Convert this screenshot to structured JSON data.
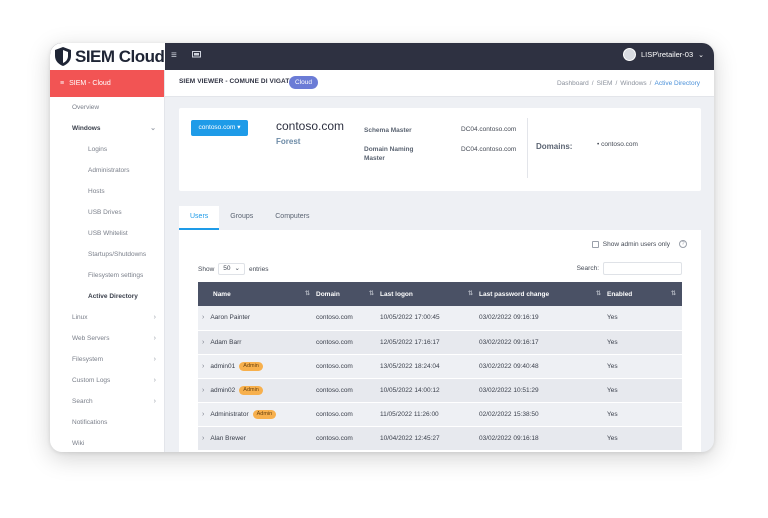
{
  "app": {
    "title": "SIEM Cloud",
    "user": "LISP\\retailer-03"
  },
  "sidebar": {
    "header": "SIEM - Cloud",
    "items": [
      {
        "label": "Overview",
        "sub": false,
        "bold": false,
        "chev": ""
      },
      {
        "label": "Windows",
        "sub": false,
        "bold": true,
        "chev": "⌄"
      },
      {
        "label": "Logins",
        "sub": true,
        "bold": false,
        "chev": ""
      },
      {
        "label": "Administrators",
        "sub": true,
        "bold": false,
        "chev": ""
      },
      {
        "label": "Hosts",
        "sub": true,
        "bold": false,
        "chev": ""
      },
      {
        "label": "USB Drives",
        "sub": true,
        "bold": false,
        "chev": ""
      },
      {
        "label": "USB Whitelist",
        "sub": true,
        "bold": false,
        "chev": ""
      },
      {
        "label": "Startups/Shutdowns",
        "sub": true,
        "bold": false,
        "chev": ""
      },
      {
        "label": "Filesystem settings",
        "sub": true,
        "bold": false,
        "chev": ""
      },
      {
        "label": "Active Directory",
        "sub": true,
        "bold": true,
        "chev": ""
      },
      {
        "label": "Linux",
        "sub": false,
        "bold": false,
        "chev": "›"
      },
      {
        "label": "Web Servers",
        "sub": false,
        "bold": false,
        "chev": "›"
      },
      {
        "label": "Filesystem",
        "sub": false,
        "bold": false,
        "chev": "›"
      },
      {
        "label": "Custom Logs",
        "sub": false,
        "bold": false,
        "chev": "›"
      },
      {
        "label": "Search",
        "sub": false,
        "bold": false,
        "chev": "›"
      },
      {
        "label": "Notifications",
        "sub": false,
        "bold": false,
        "chev": ""
      },
      {
        "label": "Wiki",
        "sub": false,
        "bold": false,
        "chev": ""
      }
    ]
  },
  "page": {
    "title": "SIEM VIEWER - COMUNE DI VIGATA",
    "badge": "Cloud",
    "breadcrumb": [
      "Dashboard",
      "/",
      "SIEM",
      "/",
      "Windows",
      "/"
    ],
    "breadcrumb_active": "Active Directory"
  },
  "domain": {
    "selector": "contoso.com ▾",
    "name": "contoso.com",
    "type": "Forest",
    "schema_master_label": "Schema Master",
    "schema_master_value": "DC04.contoso.com",
    "naming_master_label_1": "Domain Naming",
    "naming_master_label_2": "Master",
    "naming_master_value": "DC04.contoso.com",
    "domains_label": "Domains:",
    "domains_value": "• contoso.com"
  },
  "tabs": [
    "Users",
    "Groups",
    "Computers"
  ],
  "table": {
    "show_admin_label": "Show admin users only",
    "show_label": "Show",
    "page_size": "50",
    "entries_label": "entries",
    "search_label": "Search:",
    "columns": [
      "Name",
      "Domain",
      "Last logon",
      "Last password change",
      "Enabled"
    ],
    "admin_badge": "Admin",
    "rows": [
      {
        "name": "Aaron Painter",
        "admin": false,
        "domain": "contoso.com",
        "last_logon": "10/05/2022 17:00:45",
        "last_pwd": "03/02/2022 09:16:19",
        "enabled": "Yes"
      },
      {
        "name": "Adam Barr",
        "admin": false,
        "domain": "contoso.com",
        "last_logon": "12/05/2022 17:16:17",
        "last_pwd": "03/02/2022 09:16:17",
        "enabled": "Yes"
      },
      {
        "name": "admin01",
        "admin": true,
        "domain": "contoso.com",
        "last_logon": "13/05/2022 18:24:04",
        "last_pwd": "03/02/2022 09:40:48",
        "enabled": "Yes"
      },
      {
        "name": "admin02",
        "admin": true,
        "domain": "contoso.com",
        "last_logon": "10/05/2022 14:00:12",
        "last_pwd": "03/02/2022 10:51:29",
        "enabled": "Yes"
      },
      {
        "name": "Administrator",
        "admin": true,
        "domain": "contoso.com",
        "last_logon": "11/05/2022 11:26:00",
        "last_pwd": "02/02/2022 15:38:50",
        "enabled": "Yes"
      },
      {
        "name": "Alan Brewer",
        "admin": false,
        "domain": "contoso.com",
        "last_logon": "10/04/2022 12:45:27",
        "last_pwd": "03/02/2022 09:16:18",
        "enabled": "Yes"
      }
    ]
  }
}
